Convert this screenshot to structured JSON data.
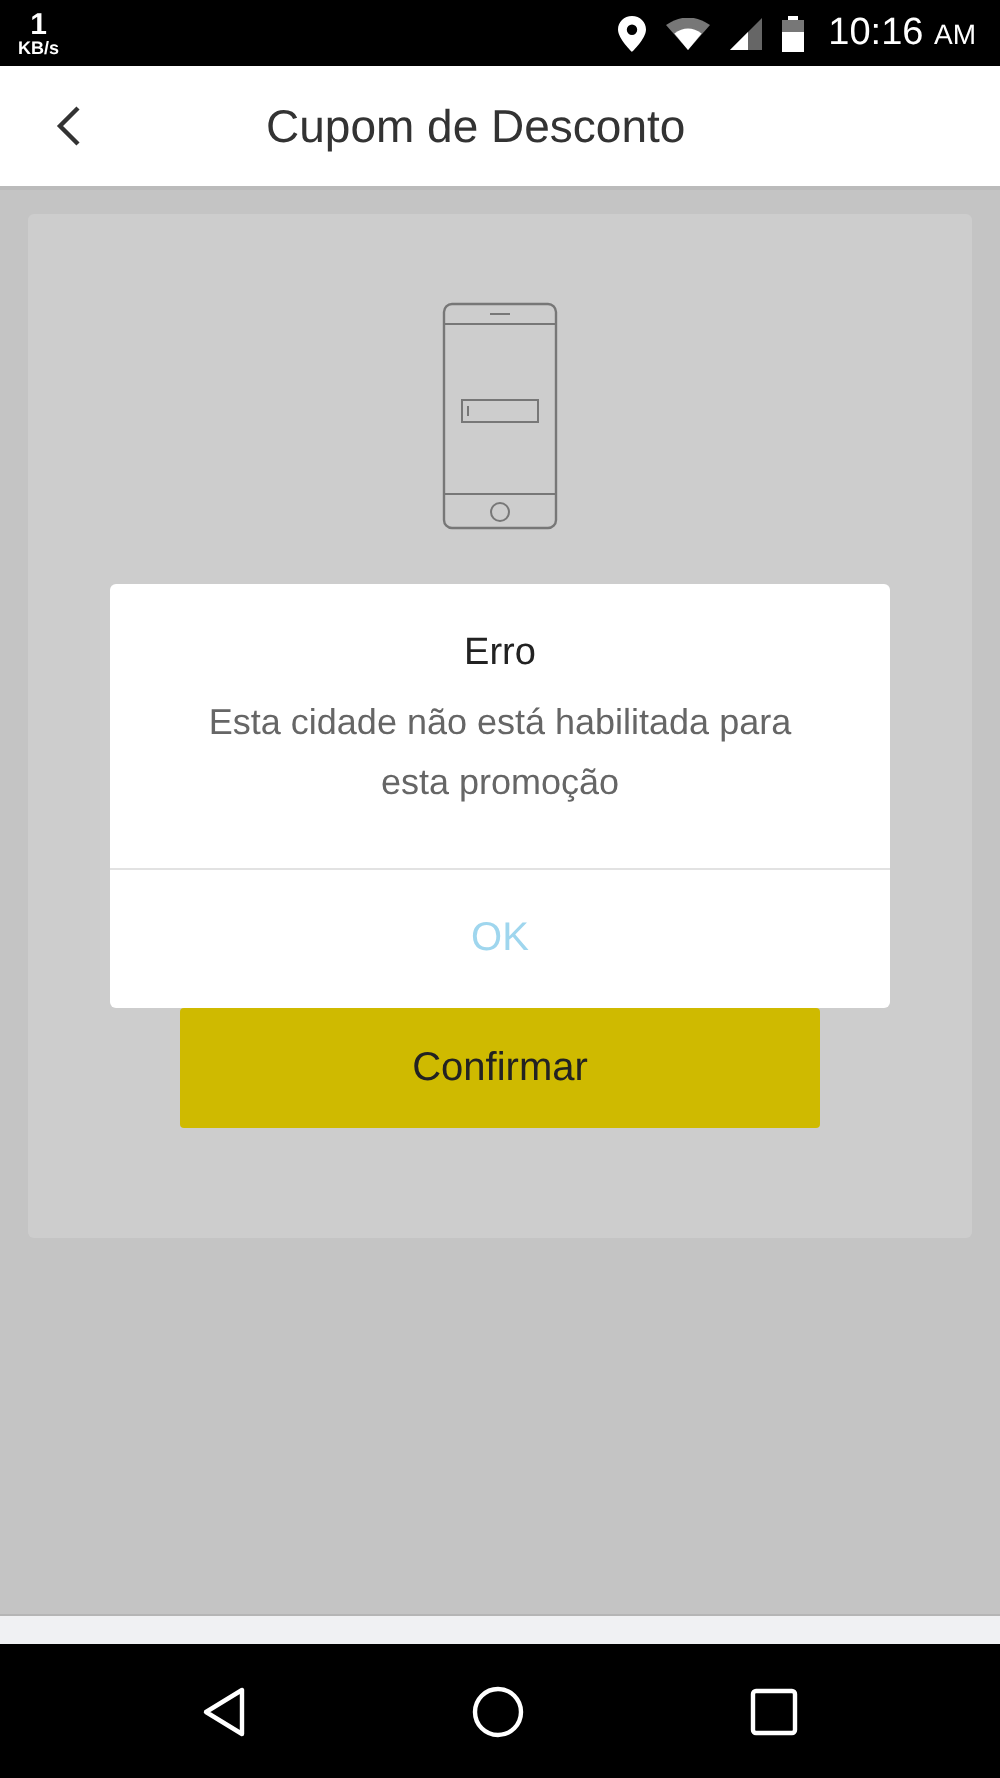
{
  "status_bar": {
    "speed": "1",
    "speed_unit": "KB/s",
    "time": "10:16",
    "meridiem": "AM"
  },
  "header": {
    "title": "Cupom de Desconto"
  },
  "card": {
    "button": "Confirmar"
  },
  "dialog": {
    "title": "Erro",
    "message": "Esta cidade não está habilitada para esta promoção",
    "button": "OK"
  }
}
